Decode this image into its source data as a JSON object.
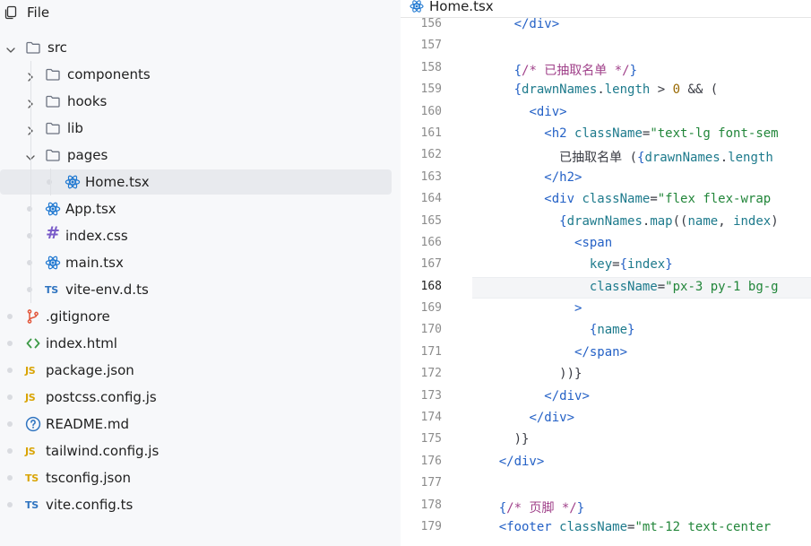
{
  "sidebar": {
    "title": "File",
    "tree": [
      {
        "label": "src",
        "type": "folder",
        "expanded": true,
        "level": 0
      },
      {
        "label": "components",
        "type": "folder",
        "expanded": false,
        "level": 1
      },
      {
        "label": "hooks",
        "type": "folder",
        "expanded": false,
        "level": 1
      },
      {
        "label": "lib",
        "type": "folder",
        "expanded": false,
        "level": 1
      },
      {
        "label": "pages",
        "type": "folder",
        "expanded": true,
        "level": 1
      },
      {
        "label": "Home.tsx",
        "type": "react",
        "level": 2,
        "selected": true
      },
      {
        "label": "App.tsx",
        "type": "react",
        "level": 1
      },
      {
        "label": "index.css",
        "type": "css",
        "level": 1
      },
      {
        "label": "main.tsx",
        "type": "react",
        "level": 1
      },
      {
        "label": "vite-env.d.ts",
        "type": "ts",
        "level": 1,
        "badge": "TS"
      },
      {
        "label": ".gitignore",
        "type": "git",
        "level": 0
      },
      {
        "label": "index.html",
        "type": "html",
        "level": 0
      },
      {
        "label": "package.json",
        "type": "js",
        "level": 0,
        "badge": "JS"
      },
      {
        "label": "postcss.config.js",
        "type": "js",
        "level": 0,
        "badge": "JS"
      },
      {
        "label": "README.md",
        "type": "info",
        "level": 0
      },
      {
        "label": "tailwind.config.js",
        "type": "js",
        "level": 0,
        "badge": "JS"
      },
      {
        "label": "tsconfig.json",
        "type": "tsjson",
        "level": 0,
        "badge": "TS"
      },
      {
        "label": "vite.config.ts",
        "type": "ts",
        "level": 0,
        "badge": "TS"
      }
    ]
  },
  "editor": {
    "tab_label": "Home.tsx",
    "active_line": "168",
    "lines": [
      {
        "num": "156",
        "indent": 6,
        "tokens": [
          [
            "tag",
            "</div>"
          ]
        ]
      },
      {
        "num": "157",
        "indent": 0,
        "tokens": []
      },
      {
        "num": "158",
        "indent": 6,
        "tokens": [
          [
            "brace",
            "{"
          ],
          [
            "com",
            "/* 已抽取名单 */"
          ],
          [
            "brace",
            "}"
          ]
        ]
      },
      {
        "num": "159",
        "indent": 6,
        "tokens": [
          [
            "brace",
            "{"
          ],
          [
            "var",
            "drawnNames"
          ],
          [
            "punc",
            "."
          ],
          [
            "var",
            "length"
          ],
          [
            "punc",
            " > "
          ],
          [
            "num",
            "0"
          ],
          [
            "punc",
            " && ("
          ]
        ]
      },
      {
        "num": "160",
        "indent": 8,
        "tokens": [
          [
            "tag",
            "<div>"
          ]
        ]
      },
      {
        "num": "161",
        "indent": 10,
        "tokens": [
          [
            "tag",
            "<h2 "
          ],
          [
            "attr",
            "className"
          ],
          [
            "punc",
            "="
          ],
          [
            "str",
            "\"text-lg font-sem"
          ]
        ]
      },
      {
        "num": "162",
        "indent": 12,
        "tokens": [
          [
            "punc",
            "已抽取名单 ("
          ],
          [
            "brace",
            "{"
          ],
          [
            "var",
            "drawnNames"
          ],
          [
            "punc",
            "."
          ],
          [
            "var",
            "length"
          ]
        ]
      },
      {
        "num": "163",
        "indent": 10,
        "tokens": [
          [
            "tag",
            "</h2>"
          ]
        ]
      },
      {
        "num": "164",
        "indent": 10,
        "tokens": [
          [
            "tag",
            "<div "
          ],
          [
            "attr",
            "className"
          ],
          [
            "punc",
            "="
          ],
          [
            "str",
            "\"flex flex-wrap "
          ]
        ]
      },
      {
        "num": "165",
        "indent": 12,
        "tokens": [
          [
            "brace",
            "{"
          ],
          [
            "var",
            "drawnNames"
          ],
          [
            "punc",
            "."
          ],
          [
            "var",
            "map"
          ],
          [
            "punc",
            "(("
          ],
          [
            "var",
            "name"
          ],
          [
            "punc",
            ", "
          ],
          [
            "var",
            "index"
          ],
          [
            "punc",
            ")"
          ]
        ]
      },
      {
        "num": "166",
        "indent": 14,
        "tokens": [
          [
            "tag",
            "<span"
          ]
        ]
      },
      {
        "num": "167",
        "indent": 16,
        "tokens": [
          [
            "attr",
            "key"
          ],
          [
            "punc",
            "="
          ],
          [
            "brace",
            "{"
          ],
          [
            "var",
            "index"
          ],
          [
            "brace",
            "}"
          ]
        ]
      },
      {
        "num": "168",
        "indent": 16,
        "tokens": [
          [
            "attr",
            "className"
          ],
          [
            "punc",
            "="
          ],
          [
            "str",
            "\"px-3 py-1 bg-g"
          ]
        ]
      },
      {
        "num": "169",
        "indent": 14,
        "tokens": [
          [
            "tag",
            ">"
          ]
        ]
      },
      {
        "num": "170",
        "indent": 16,
        "tokens": [
          [
            "brace",
            "{"
          ],
          [
            "var",
            "name"
          ],
          [
            "brace",
            "}"
          ]
        ]
      },
      {
        "num": "171",
        "indent": 14,
        "tokens": [
          [
            "tag",
            "</span>"
          ]
        ]
      },
      {
        "num": "172",
        "indent": 12,
        "tokens": [
          [
            "punc",
            "))}"
          ]
        ]
      },
      {
        "num": "173",
        "indent": 10,
        "tokens": [
          [
            "tag",
            "</div>"
          ]
        ]
      },
      {
        "num": "174",
        "indent": 8,
        "tokens": [
          [
            "tag",
            "</div>"
          ]
        ]
      },
      {
        "num": "175",
        "indent": 6,
        "tokens": [
          [
            "punc",
            ")}"
          ]
        ]
      },
      {
        "num": "176",
        "indent": 4,
        "tokens": [
          [
            "tag",
            "</div>"
          ]
        ]
      },
      {
        "num": "177",
        "indent": 0,
        "tokens": []
      },
      {
        "num": "178",
        "indent": 4,
        "tokens": [
          [
            "brace",
            "{"
          ],
          [
            "com",
            "/* 页脚 */"
          ],
          [
            "brace",
            "}"
          ]
        ]
      },
      {
        "num": "179",
        "indent": 4,
        "tokens": [
          [
            "tag",
            "<footer "
          ],
          [
            "attr",
            "className"
          ],
          [
            "punc",
            "="
          ],
          [
            "str",
            "\"mt-12 text-center "
          ]
        ]
      }
    ]
  },
  "colors": {
    "folder": "#6b7280",
    "react": "#1f78d1",
    "ts": "#2f74c0",
    "js": "#d9a404",
    "git": "#e2573b",
    "html": "#3d9a47",
    "css": "#7a5cc9",
    "info": "#2f74c0"
  }
}
